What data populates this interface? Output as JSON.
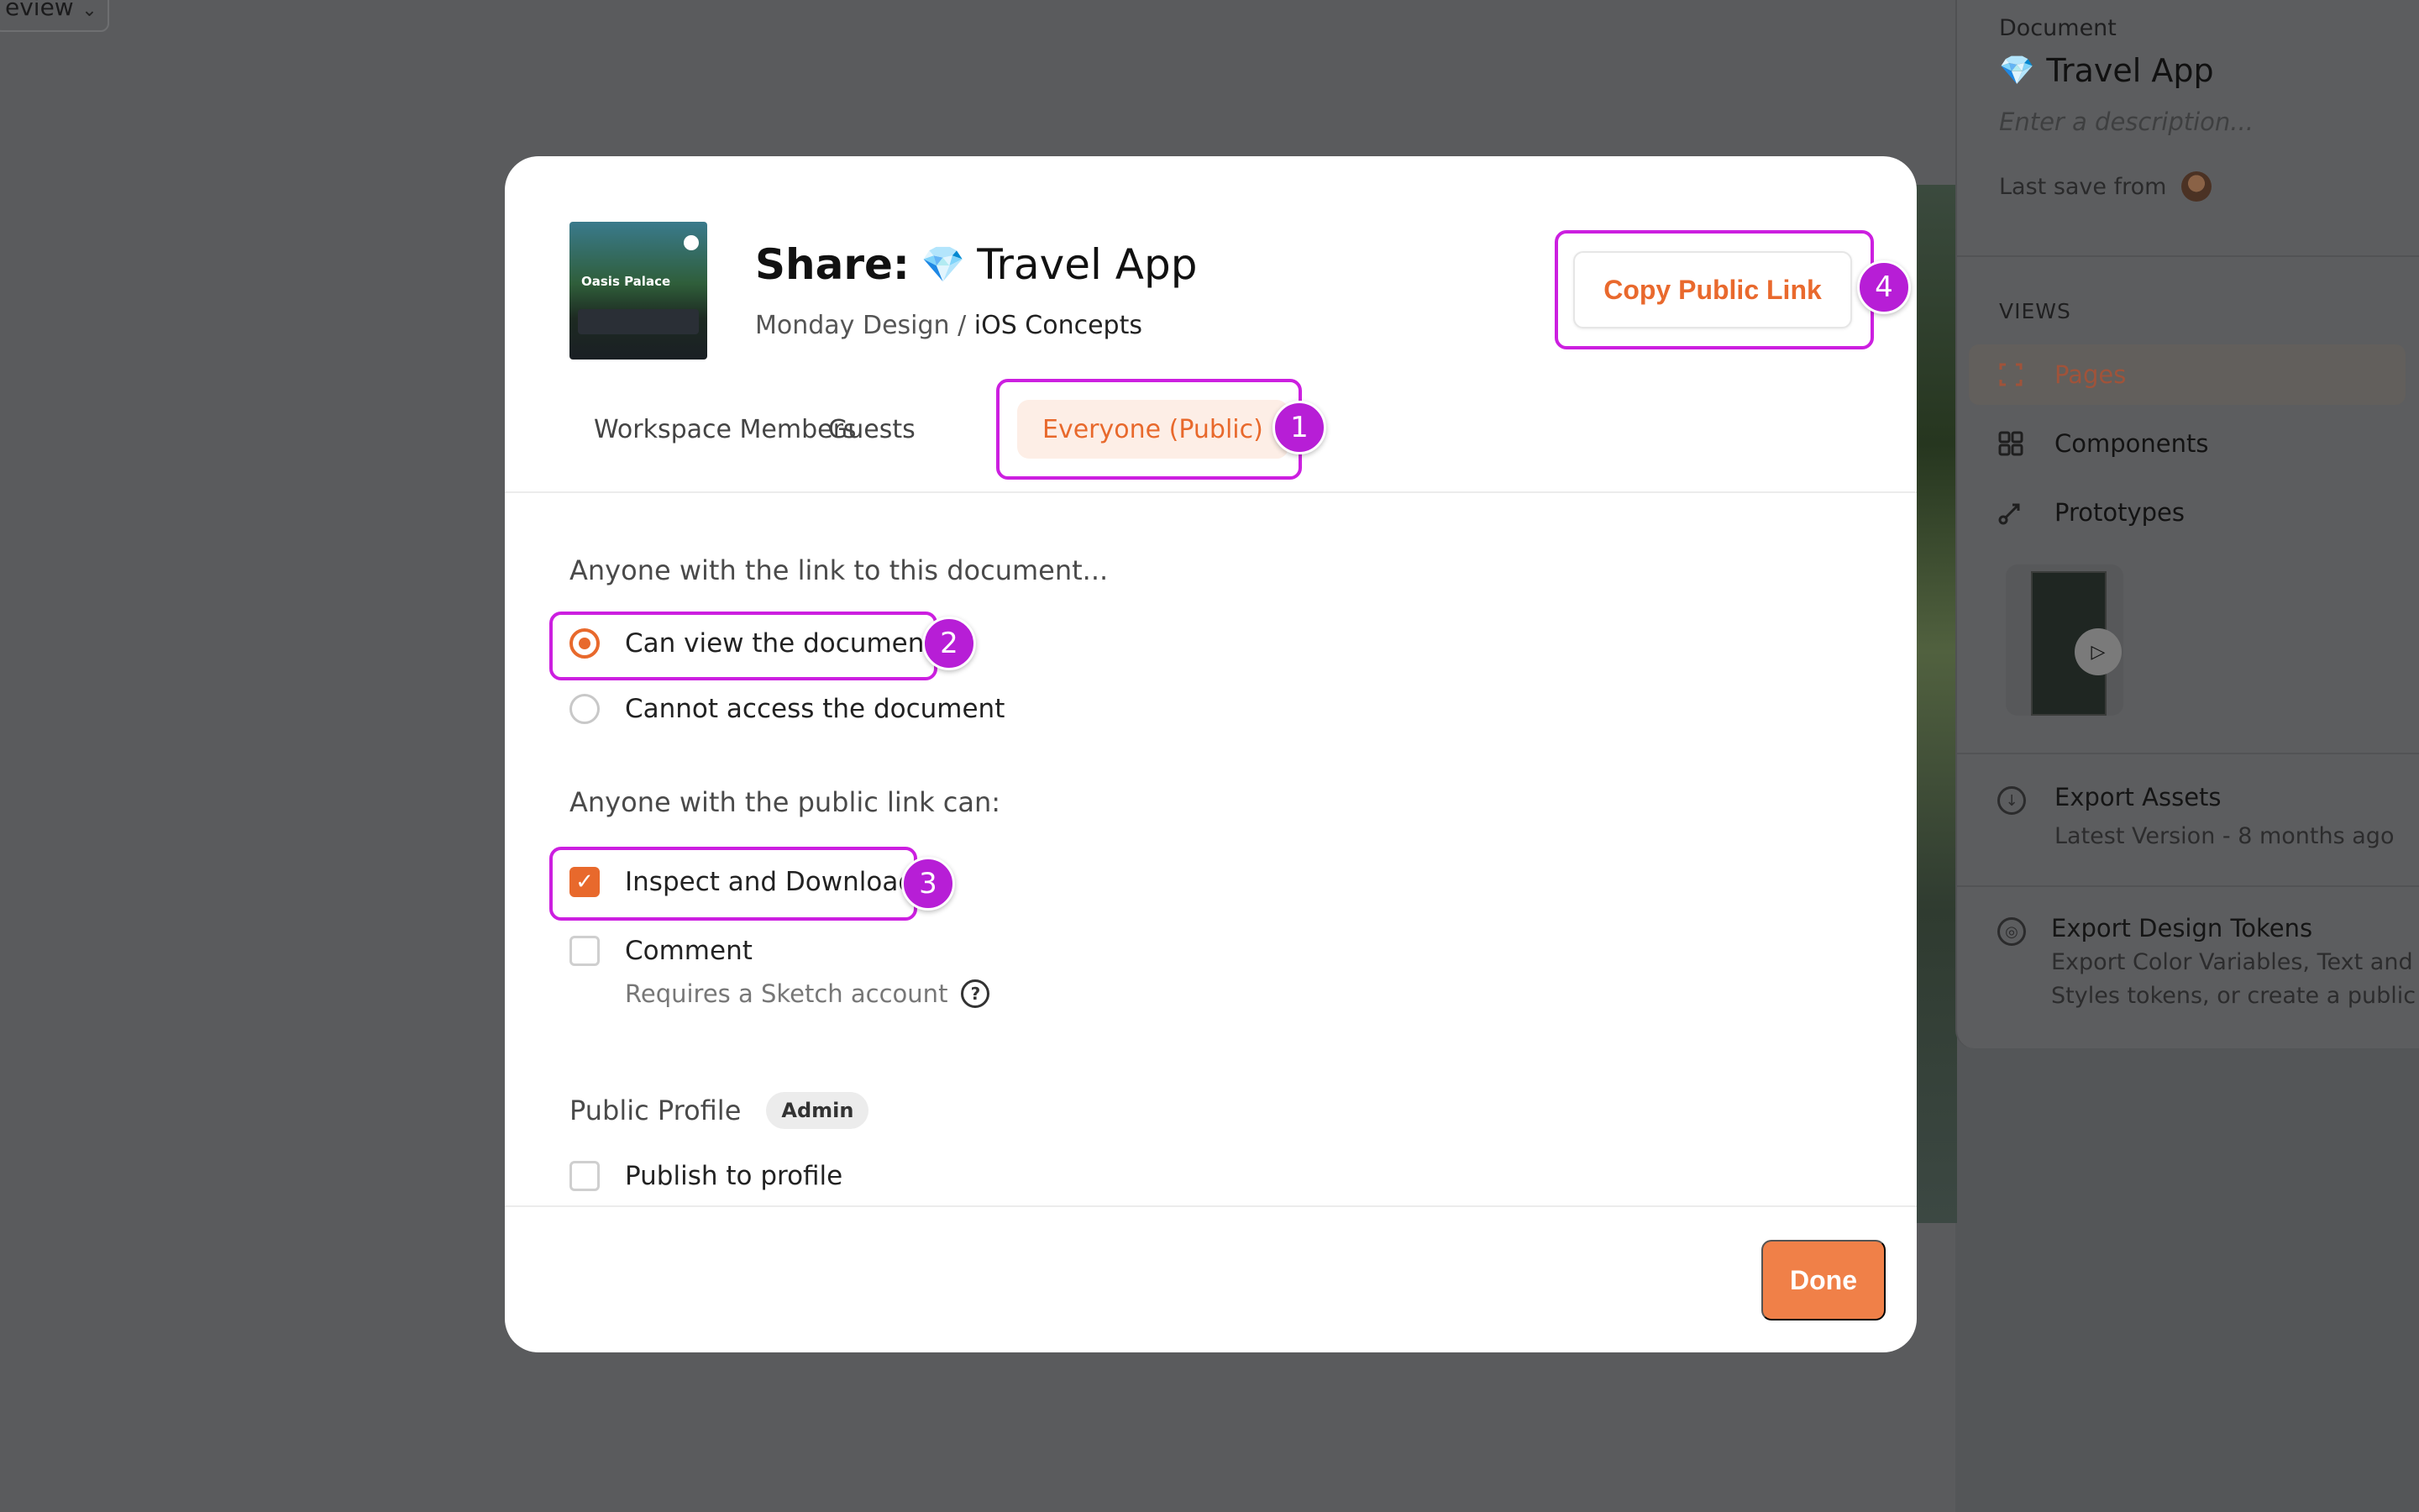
{
  "background": {
    "view_button_label": "eview",
    "panel": {
      "document_label": "Document",
      "title": "Travel App",
      "description_placeholder": "Enter a description...",
      "last_save_label": "Last save from",
      "views_label": "VIEWS",
      "views": [
        {
          "label": "Pages",
          "icon": "pages-icon",
          "active": true
        },
        {
          "label": "Components",
          "icon": "components-icon",
          "active": false
        },
        {
          "label": "Prototypes",
          "icon": "prototypes-icon",
          "active": false
        }
      ],
      "export_assets": {
        "title": "Export Assets",
        "subtitle": "Latest Version - 8 months ago"
      },
      "export_tokens": {
        "title": "Export Design Tokens",
        "subtitle_line1": "Export Color Variables, Text and",
        "subtitle_line2": "Styles tokens, or create a public"
      }
    }
  },
  "modal": {
    "thumbnail_text": "Oasis Palace",
    "title_prefix": "Share:",
    "title_emoji": "💎",
    "title": "Travel App",
    "breadcrumb_workspace": "Monday Design",
    "breadcrumb_separator": " / ",
    "breadcrumb_project": "iOS Concepts",
    "copy_button_label": "Copy Public Link",
    "tabs": [
      {
        "label": "Workspace Members",
        "active": false
      },
      {
        "label": "Guests",
        "active": false
      },
      {
        "label": "Everyone (Public)",
        "active": true
      }
    ],
    "access_section_label": "Anyone with the link to this document...",
    "access_options": [
      {
        "label": "Can view the document",
        "selected": true
      },
      {
        "label": "Cannot access the document",
        "selected": false
      }
    ],
    "permissions_section_label": "Anyone with the public link can:",
    "permissions": [
      {
        "label": "Inspect and Download",
        "checked": true
      },
      {
        "label": "Comment",
        "checked": false
      }
    ],
    "comment_note": "Requires a Sketch account",
    "help_glyph": "?",
    "profile_section_label": "Public Profile",
    "profile_badge": "Admin",
    "publish_label": "Publish to profile",
    "publish_checked": false,
    "done_label": "Done"
  },
  "annotations": {
    "badges": [
      "1",
      "2",
      "3",
      "4"
    ],
    "highlight_color": "#cc1fe0"
  },
  "colors": {
    "accent": "#e8692c",
    "annotation": "#b71ed6",
    "done_button": "#f08048"
  }
}
